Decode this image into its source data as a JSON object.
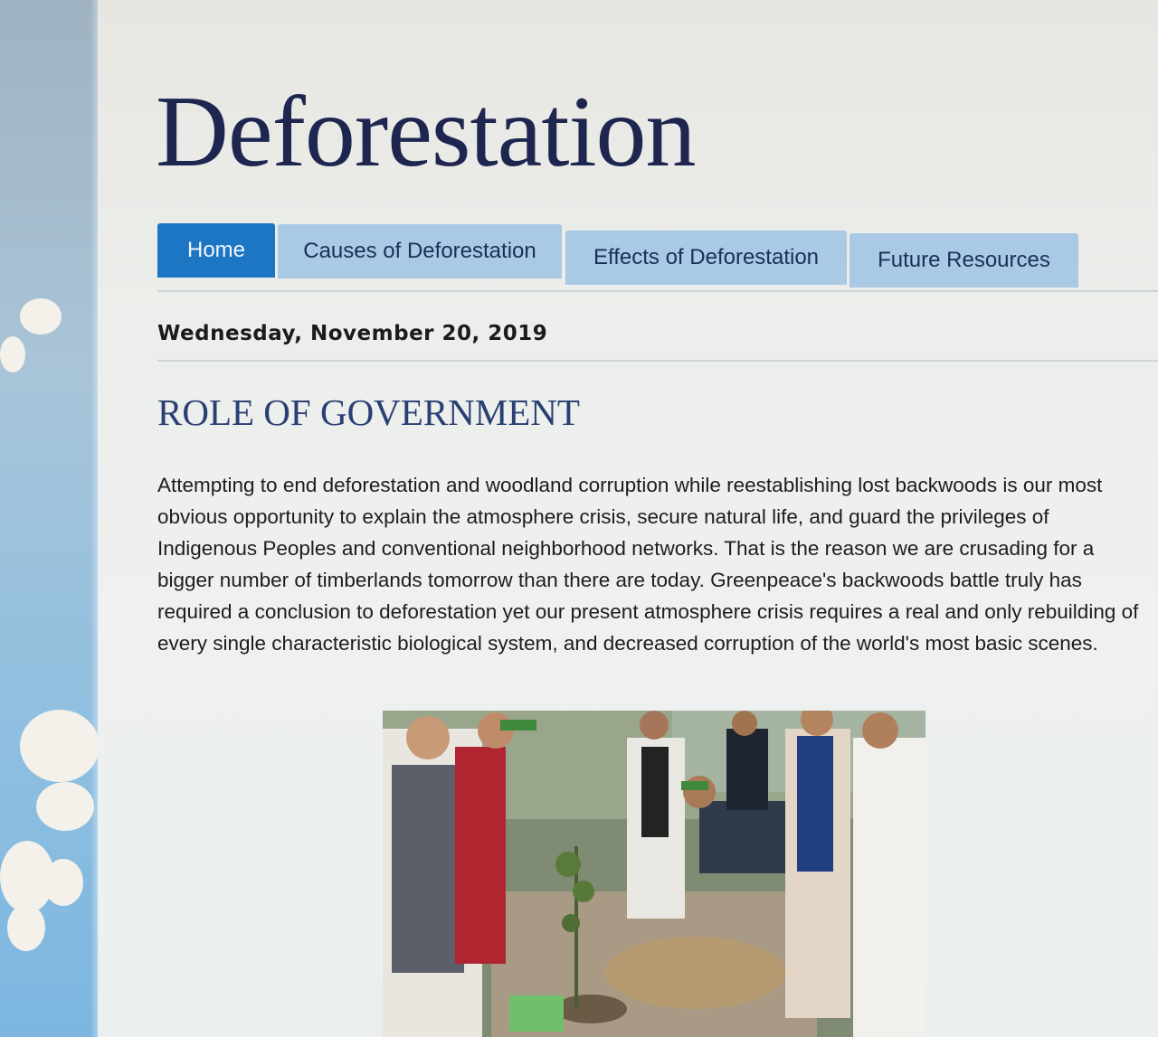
{
  "blog": {
    "title": "Deforestation"
  },
  "nav": {
    "tabs": [
      {
        "label": "Home",
        "active": true
      },
      {
        "label": "Causes of Deforestation",
        "active": false
      },
      {
        "label": "Effects of Deforestation",
        "active": false
      },
      {
        "label": "Future Resources",
        "active": false
      }
    ]
  },
  "post": {
    "date": "Wednesday, November 20, 2019",
    "title": "ROLE OF GOVERNMENT",
    "body": "Attempting to end deforestation and woodland corruption while reestablishing lost backwoods is our most obvious opportunity to explain the atmosphere crisis, secure natural life, and guard the privileges of Indigenous Peoples and conventional neighborhood networks. That is the reason we are crusading for a bigger number of timberlands tomorrow than there are today. Greenpeace's backwoods battle truly has required a conclusion to deforestation yet our present atmosphere crisis requires a real and only rebuilding of every single characteristic biological system, and decreased corruption of the world's most basic scenes."
  },
  "colors": {
    "nav_active": "#1c76c4",
    "nav_inactive": "#a9c9e4",
    "title": "#1e2650",
    "post_title": "#2a3f74"
  }
}
